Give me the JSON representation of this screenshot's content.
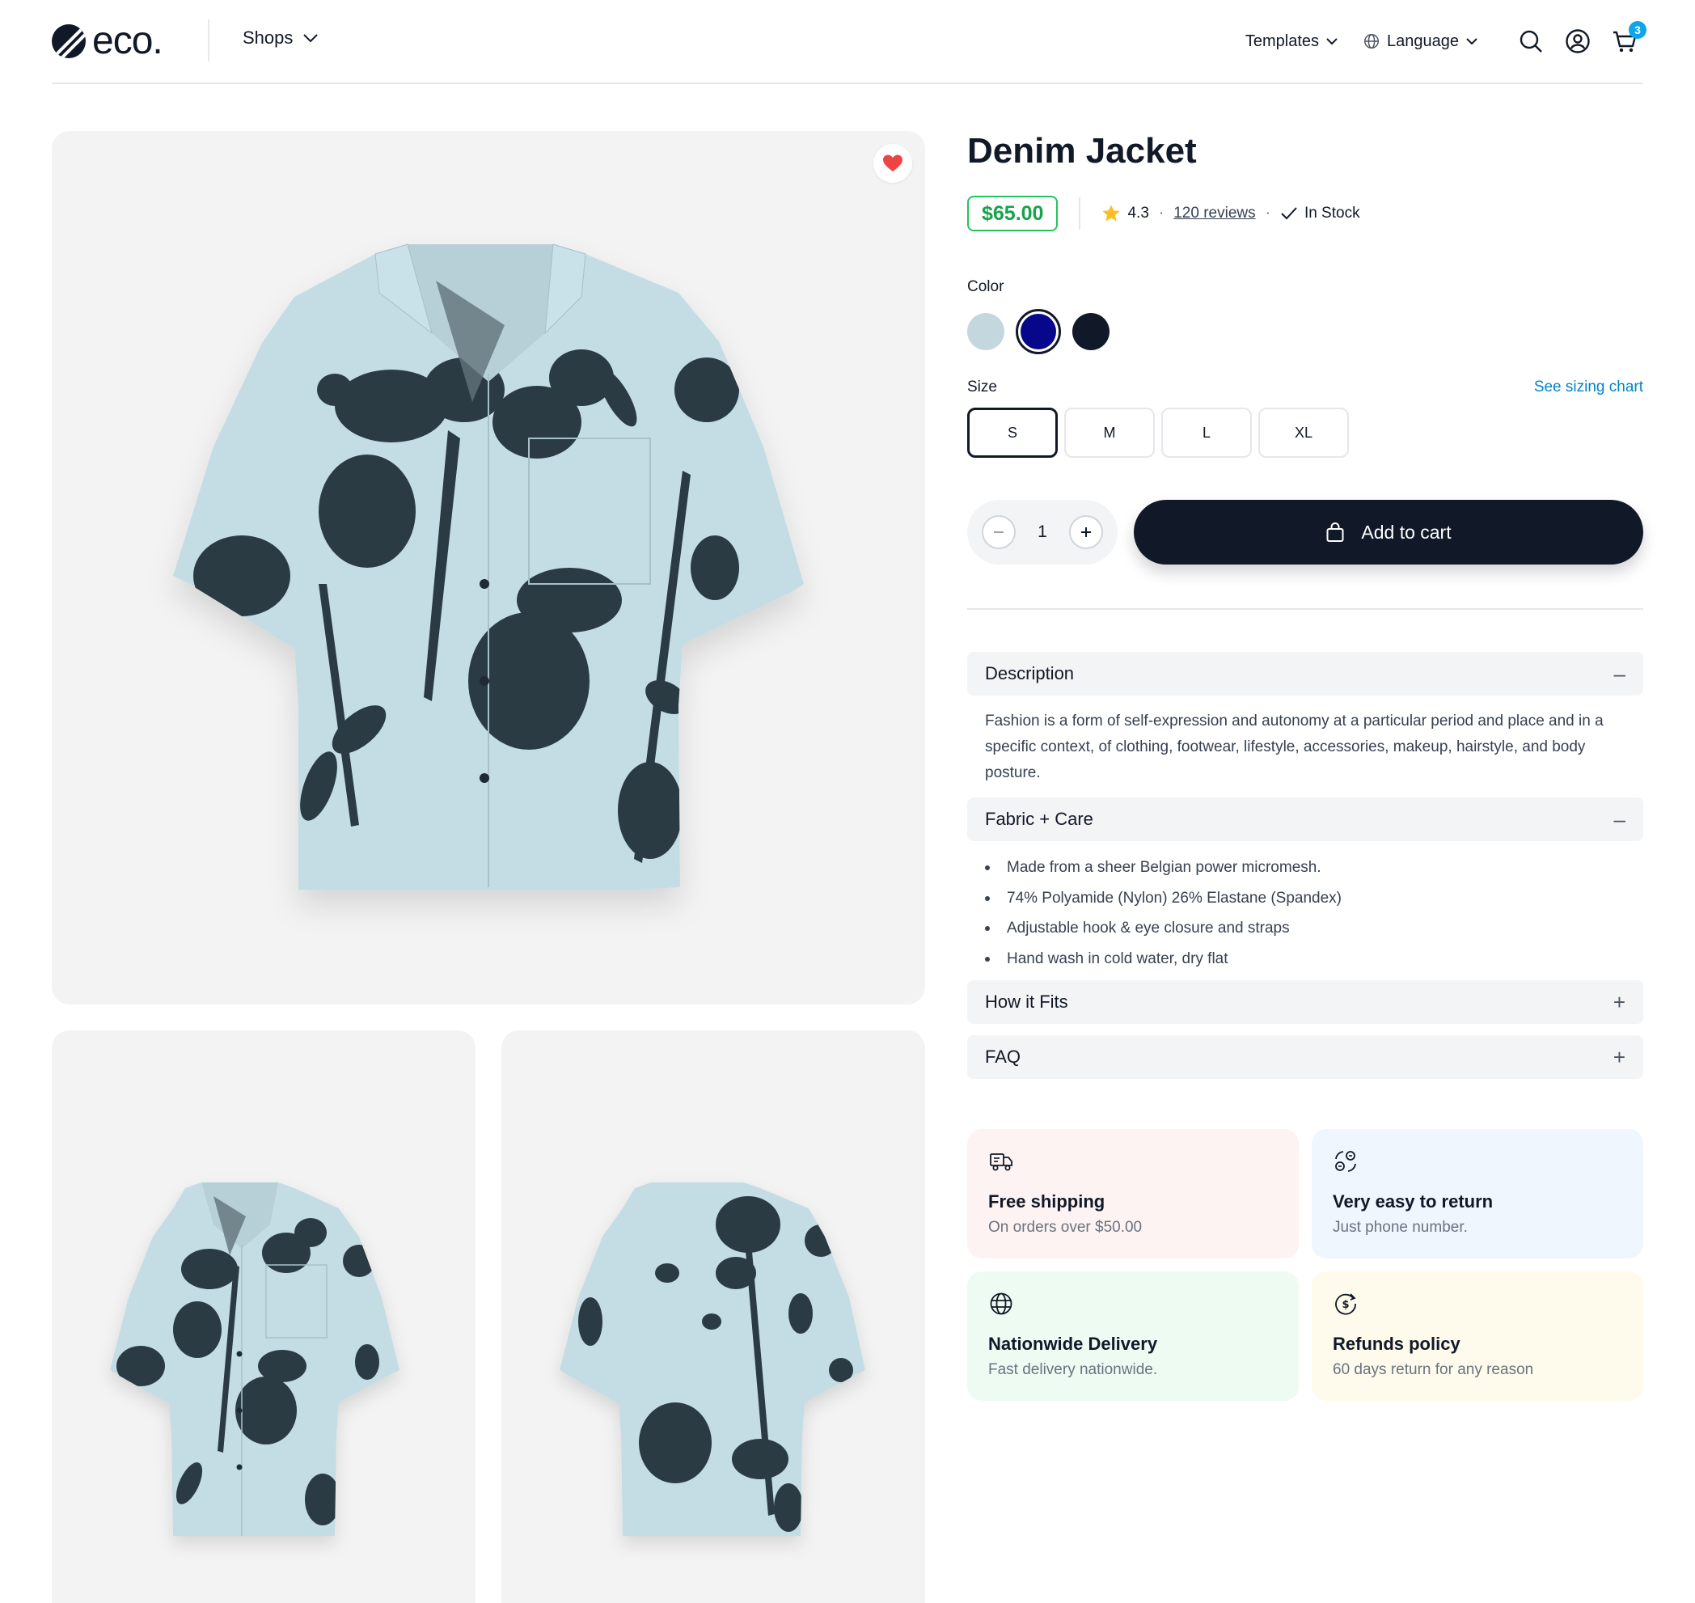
{
  "header": {
    "logo_text": "eco.",
    "shops_label": "Shops",
    "templates_label": "Templates",
    "language_label": "Language",
    "cart_count": "3"
  },
  "product": {
    "title": "Denim Jacket",
    "price": "$65.00",
    "rating": "4.3",
    "reviews": "120 reviews",
    "stock": "In Stock",
    "color_label": "Color",
    "colors": [
      "#c4d7df",
      "#07078c",
      "#111827"
    ],
    "selected_color_index": 1,
    "size_label": "Size",
    "sizing_chart_link": "See sizing chart",
    "sizes": [
      "S",
      "M",
      "L",
      "XL"
    ],
    "selected_size": "S",
    "quantity": "1",
    "add_to_cart": "Add to cart"
  },
  "accordion": {
    "description": {
      "title": "Description",
      "body": "Fashion is a form of self-expression and autonomy at a particular period and place and in a specific context, of clothing, footwear, lifestyle, accessories, makeup, hairstyle, and body posture."
    },
    "fabric": {
      "title": "Fabric + Care",
      "items": [
        "Made from a sheer Belgian power micromesh.",
        "74% Polyamide (Nylon) 26% Elastane (Spandex)",
        "Adjustable hook & eye closure and straps",
        "Hand wash in cold water, dry flat"
      ]
    },
    "fits": {
      "title": "How it Fits"
    },
    "faq": {
      "title": "FAQ"
    },
    "expanded_sign": "–",
    "collapsed_sign": "+"
  },
  "features": [
    {
      "title": "Free shipping",
      "subtitle": "On orders over $50.00",
      "icon": "truck-icon",
      "bg": "#fdf3f2"
    },
    {
      "title": "Very easy to return",
      "subtitle": "Just phone number.",
      "icon": "return-icon",
      "bg": "#eff6fd"
    },
    {
      "title": "Nationwide Delivery",
      "subtitle": "Fast delivery nationwide.",
      "icon": "globe-icon",
      "bg": "#eefbf3"
    },
    {
      "title": "Refunds policy",
      "subtitle": "60 days return for any reason",
      "icon": "refund-icon",
      "bg": "#fefbec"
    }
  ],
  "colors": {
    "primary": "#111827",
    "price_green": "#16a34a",
    "link_blue": "#0284c7",
    "favorite_red": "#ef4444",
    "shirt": "#c4dde4",
    "print": "#2a3b44"
  }
}
